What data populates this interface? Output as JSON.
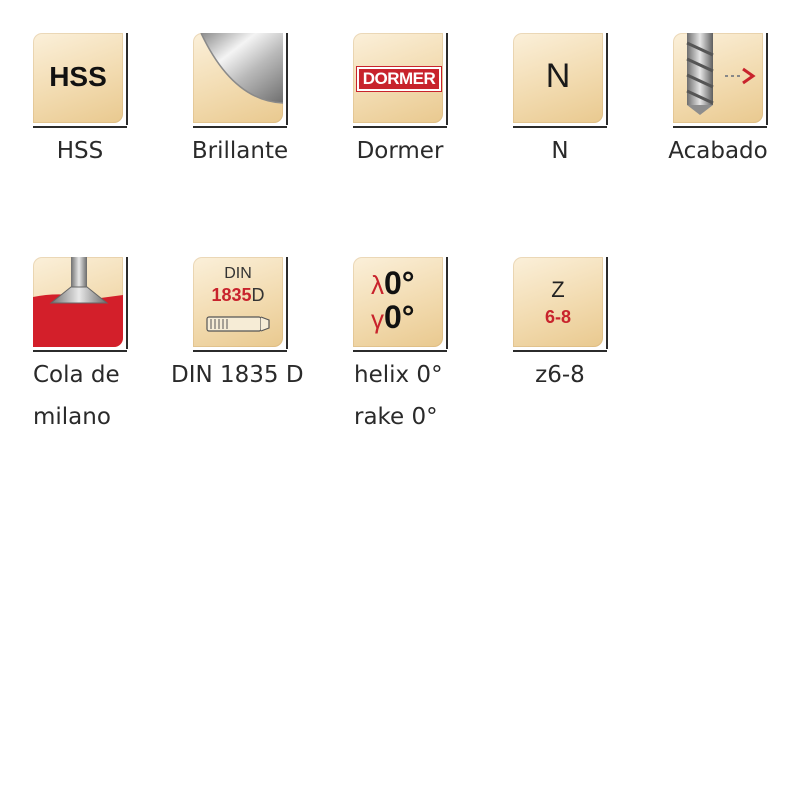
{
  "icons": [
    {
      "id": "hss",
      "icon": "hss-material-icon",
      "icon_text": "HSS",
      "label": "HSS"
    },
    {
      "id": "brillante",
      "icon": "bright-finish-icon",
      "label": "Brillante"
    },
    {
      "id": "dormer",
      "icon": "dormer-brand-icon",
      "icon_text": "DORMER",
      "label": "Dormer"
    },
    {
      "id": "n",
      "icon": "type-n-icon",
      "icon_text": "N",
      "label": "N"
    },
    {
      "id": "acabado",
      "icon": "finishing-cutter-icon",
      "label": "Acabado"
    },
    {
      "id": "cola",
      "icon": "dovetail-cutter-icon",
      "label_line1": "Cola de",
      "label_line2": "milano"
    },
    {
      "id": "din",
      "icon": "din-standard-icon",
      "icon_text_top": "DIN",
      "icon_text_num": "1835",
      "icon_text_suffix": "D",
      "label": "DIN 1835 D"
    },
    {
      "id": "angles",
      "icon": "helix-rake-angle-icon",
      "lambda": "λ",
      "gamma": "γ",
      "lambda_val": "0°",
      "gamma_val": "0°",
      "label_line1": "helix 0°",
      "label_line2": "rake 0°"
    },
    {
      "id": "z",
      "icon": "flute-count-icon",
      "icon_text_top": "Z",
      "icon_text_bottom": "6-8",
      "label": "z6-8"
    }
  ],
  "colors": {
    "accent_red": "#c8232c",
    "tile_light": "#fbf0da",
    "tile_dark": "#e9c98f"
  }
}
